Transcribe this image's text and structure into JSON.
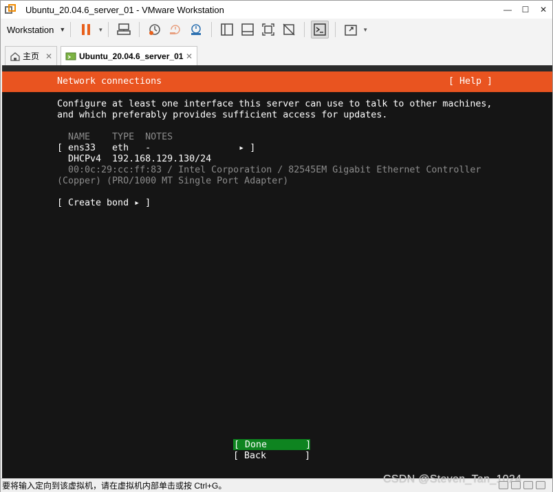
{
  "window": {
    "title": "Ubuntu_20.04.6_server_01 - VMware Workstation",
    "minimize": "—",
    "maximize": "☐",
    "close": "✕"
  },
  "toolbar": {
    "menu_label": "Workstation",
    "icons": [
      "pause-icon",
      "send-ctrl-alt-del-icon",
      "snapshot-icon",
      "revert-snapshot-icon",
      "manage-snapshots-icon",
      "library-icon",
      "thumbnail-icon",
      "fullscreen-icon",
      "unity-icon",
      "console-view-icon",
      "stretch-icon"
    ]
  },
  "tabs": [
    {
      "label": "主页",
      "icon": "home-icon"
    },
    {
      "label": "Ubuntu_20.04.6_server_01",
      "icon": "vm-icon"
    }
  ],
  "console": {
    "header_title": "Network connections",
    "help": "[ Help ]",
    "intro_line1": "Configure at least one interface this server can use to talk to other machines,",
    "intro_line2": "and which preferably provides sufficient access for updates.",
    "table_header": "  NAME    TYPE  NOTES",
    "iface_row": "[ ens33   eth   -                ▸ ]",
    "iface_addr": "  DHCPv4  192.168.129.130/24",
    "iface_mac": "  00:0c:29:cc:ff:83 / Intel Corporation / 82545EM Gigabit Ethernet Controller",
    "iface_desc": "(Copper) (PRO/1000 MT Single Port Adapter)",
    "create_bond": "[ Create bond ▸ ]",
    "done_button": "[ Done       ]",
    "back_button": "[ Back       ]"
  },
  "status": {
    "text": "要将输入定向到该虚拟机，请在虚拟机内部单击或按 Ctrl+G。",
    "watermark": "CSDN @Steven_Tan_1024"
  },
  "colors": {
    "ubuntu_orange": "#e95420",
    "done_green": "#0e8420",
    "console_bg": "#151515",
    "pause_orange": "#e8601c"
  }
}
